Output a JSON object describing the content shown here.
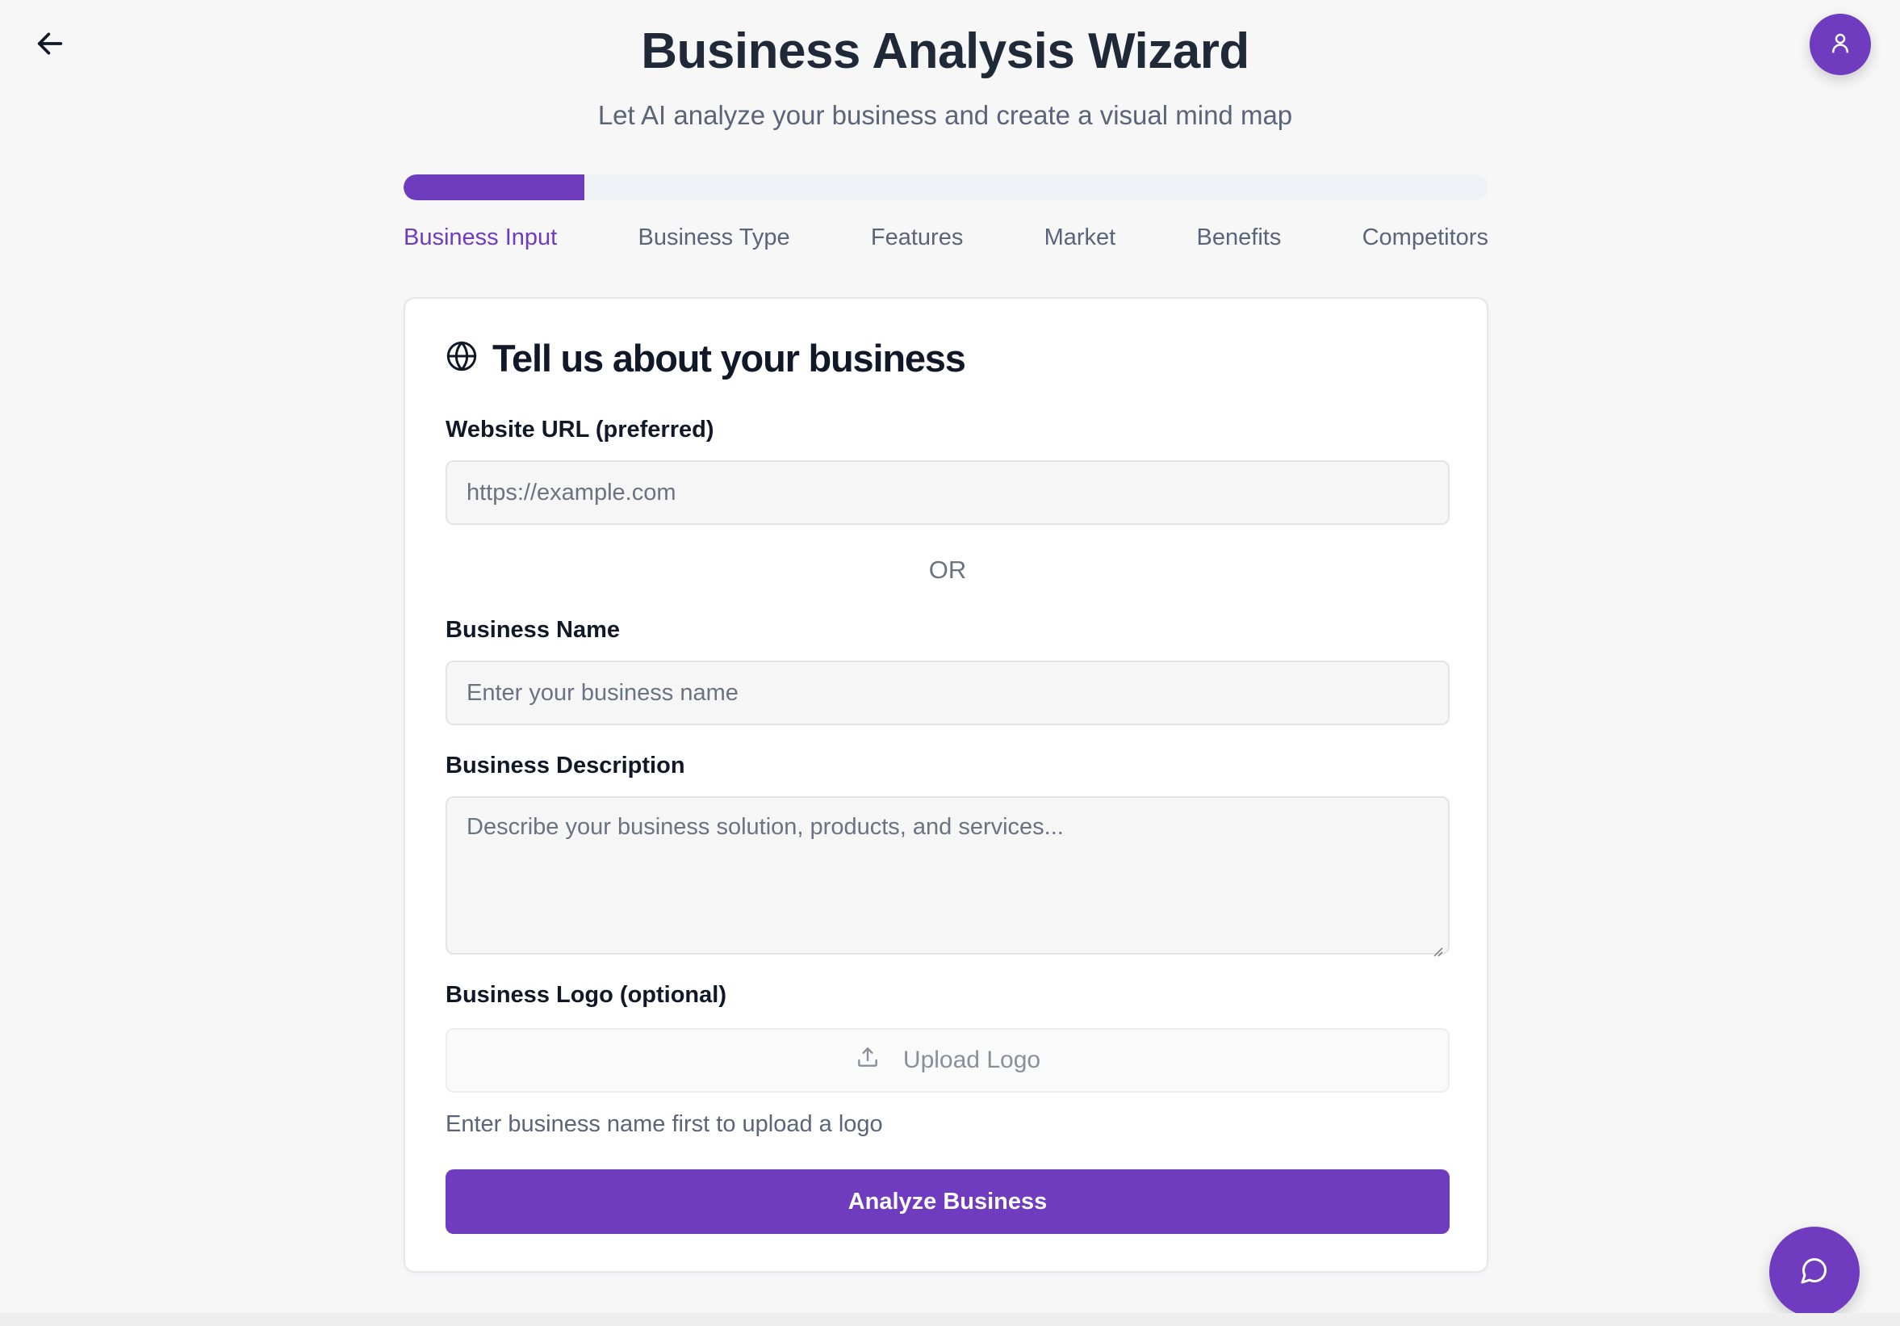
{
  "header": {
    "title": "Business Analysis Wizard",
    "subtitle": "Let AI analyze your business and create a visual mind map"
  },
  "progress": {
    "fraction": 0.167,
    "current_step": 1,
    "total_steps": 6
  },
  "steps": [
    {
      "label": "Business Input",
      "active": true
    },
    {
      "label": "Business Type",
      "active": false
    },
    {
      "label": "Features",
      "active": false
    },
    {
      "label": "Market",
      "active": false
    },
    {
      "label": "Benefits",
      "active": false
    },
    {
      "label": "Competitors",
      "active": false
    }
  ],
  "card": {
    "heading": "Tell us about your business",
    "heading_icon": "globe-icon",
    "website": {
      "label": "Website URL (preferred)",
      "placeholder": "https://example.com",
      "value": ""
    },
    "or_text": "OR",
    "business_name": {
      "label": "Business Name",
      "placeholder": "Enter your business name",
      "value": ""
    },
    "business_description": {
      "label": "Business Description",
      "placeholder": "Describe your business solution, products, and services...",
      "value": ""
    },
    "logo": {
      "label": "Business Logo (optional)",
      "button_label": "Upload Logo",
      "button_icon": "upload-icon",
      "helper": "Enter business name first to upload a logo"
    },
    "submit_label": "Analyze Business"
  },
  "icons": {
    "back": "arrow-left-icon",
    "avatar": "user-icon",
    "chat": "message-circle-icon"
  },
  "colors": {
    "accent": "#6f3bbf",
    "background": "#f7f7f8",
    "text_muted": "#5b6478"
  }
}
